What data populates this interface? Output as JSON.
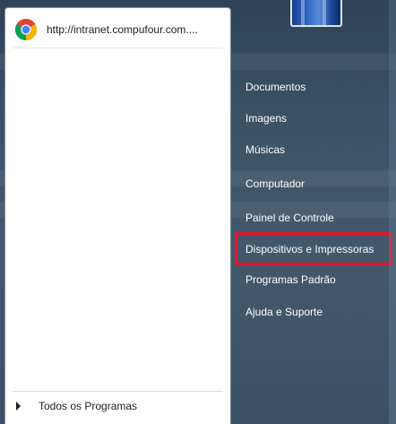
{
  "pinned": {
    "label": "http://intranet.compufour.com....",
    "icon": "chrome-icon"
  },
  "all_programs": {
    "label": "Todos os Programas",
    "icon": "arrow-right-icon"
  },
  "right_menu": {
    "items": [
      {
        "label": "Documentos"
      },
      {
        "label": "Imagens"
      },
      {
        "label": "Músicas"
      },
      {
        "label": "Computador"
      },
      {
        "label": "Painel de Controle"
      },
      {
        "label": "Dispositivos e Impressoras"
      },
      {
        "label": "Programas Padrão"
      },
      {
        "label": "Ajuda e Suporte"
      }
    ],
    "highlighted_label": "Dispositivos e Impressoras"
  },
  "colors": {
    "highlight_border": "#e3162a",
    "menu_text": "#ffffff"
  }
}
